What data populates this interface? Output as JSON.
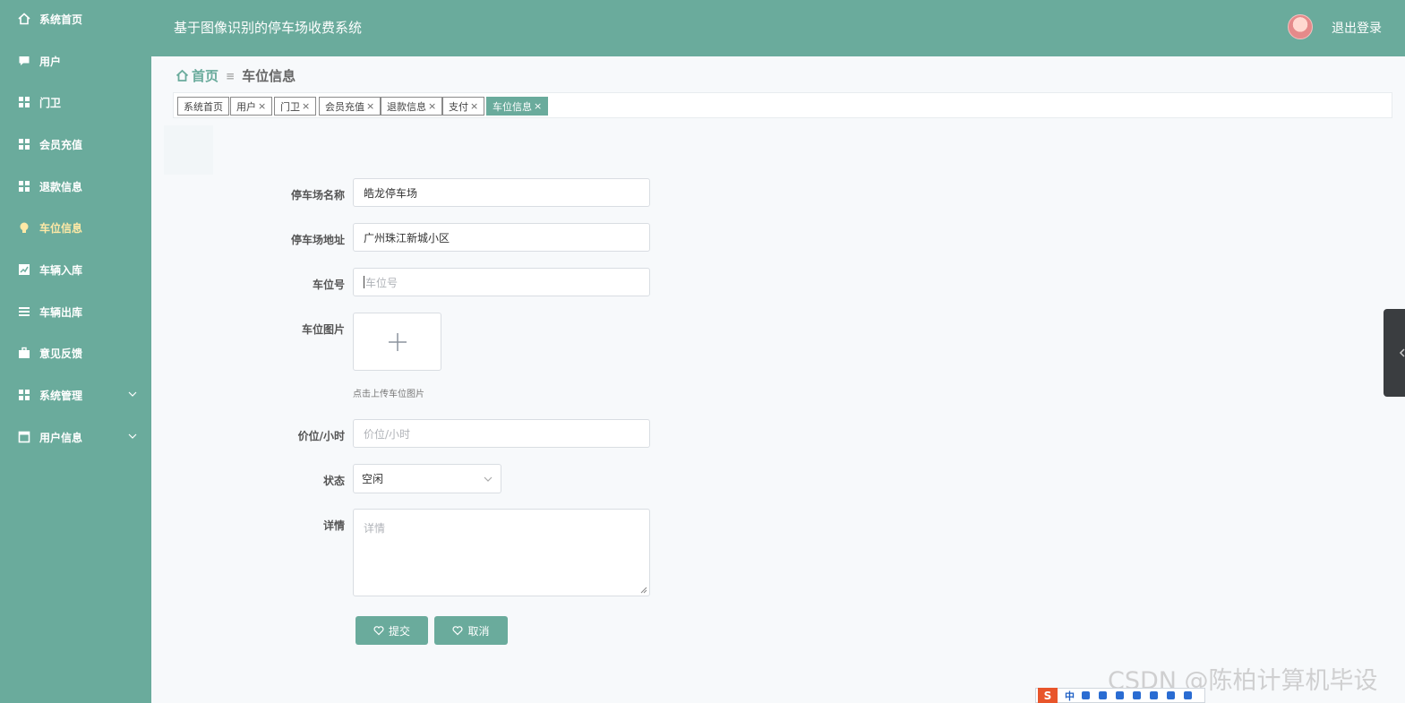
{
  "sidebar": {
    "items": [
      {
        "label": "系统首页",
        "icon": "home-icon"
      },
      {
        "label": "用户",
        "icon": "chat-icon"
      },
      {
        "label": "门卫",
        "icon": "grid-icon"
      },
      {
        "label": "会员充值",
        "icon": "grid-icon"
      },
      {
        "label": "退款信息",
        "icon": "grid-icon"
      },
      {
        "label": "车位信息",
        "icon": "bulb-icon",
        "active": true
      },
      {
        "label": "车辆入库",
        "icon": "chart-icon"
      },
      {
        "label": "车辆出库",
        "icon": "list-icon"
      },
      {
        "label": "意见反馈",
        "icon": "briefcase-icon"
      },
      {
        "label": "系统管理",
        "icon": "grid-icon",
        "expandable": true
      },
      {
        "label": "用户信息",
        "icon": "window-icon",
        "expandable": true
      }
    ]
  },
  "header": {
    "title": "基于图像识别的停车场收费系统",
    "logout_label": "退出登录"
  },
  "breadcrumb": {
    "home": "首页",
    "current": "车位信息"
  },
  "tags": [
    {
      "label": "系统首页",
      "closable": false
    },
    {
      "label": "用户",
      "closable": true
    },
    {
      "label": "门卫",
      "closable": true
    },
    {
      "label": "会员充值",
      "closable": true
    },
    {
      "label": "退款信息",
      "closable": true
    },
    {
      "label": "支付",
      "closable": true
    },
    {
      "label": "车位信息",
      "closable": true,
      "active": true
    }
  ],
  "tag_close_glyph": "×",
  "form": {
    "lot_name": {
      "label": "停车场名称",
      "value": "皓龙停车场"
    },
    "lot_address": {
      "label": "停车场地址",
      "value": "广州珠江新城小区"
    },
    "space_no": {
      "label": "车位号",
      "placeholder": "车位号"
    },
    "space_image": {
      "label": "车位图片",
      "hint": "点击上传车位图片"
    },
    "price": {
      "label": "价位/小时",
      "placeholder": "价位/小时"
    },
    "status": {
      "label": "状态",
      "value": "空闲"
    },
    "details": {
      "label": "详情",
      "placeholder": "详情"
    },
    "submit_label": "提交",
    "cancel_label": "取消"
  },
  "colors": {
    "theme": "#6aab9c",
    "active_nav": "#ffe9a6"
  },
  "watermark": "CSDN @陈柏计算机毕设",
  "ime": {
    "logo": "S",
    "mode": "中"
  }
}
